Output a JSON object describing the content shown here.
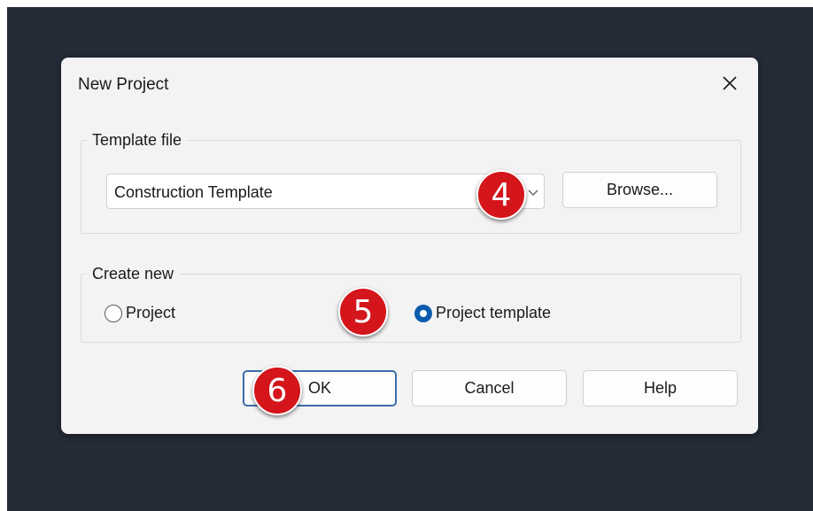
{
  "dialog": {
    "title": "New Project",
    "close_icon": "close-icon"
  },
  "template_group": {
    "legend": "Template file",
    "selected_value": "Construction Template",
    "browse_label": "Browse..."
  },
  "create_group": {
    "legend": "Create new",
    "options": [
      {
        "label": "Project",
        "checked": false
      },
      {
        "label": "Project template",
        "checked": true
      }
    ]
  },
  "buttons": {
    "ok_label": "OK",
    "cancel_label": "Cancel",
    "help_label": "Help"
  },
  "annotations": [
    "4",
    "5",
    "6"
  ],
  "colors": {
    "backdrop": "#252c38",
    "dialog": "#f3f3f3",
    "accent": "#0b5cad",
    "badge": "#d4151b"
  }
}
